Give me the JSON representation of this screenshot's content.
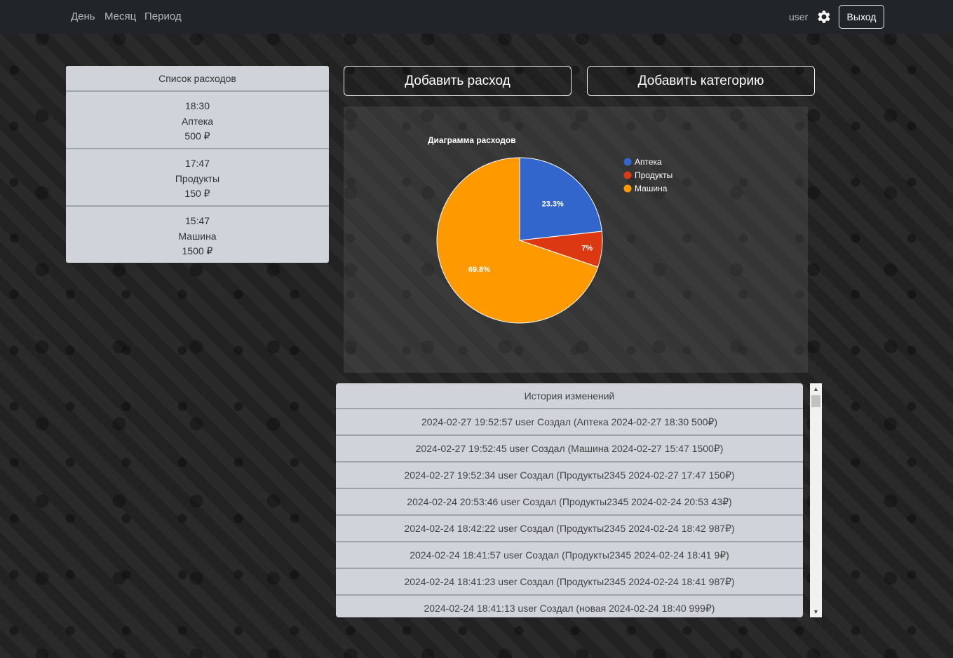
{
  "nav": {
    "links": [
      "День",
      "Месяц",
      "Период"
    ],
    "user": "user",
    "logout": "Выход"
  },
  "expenses": {
    "title": "Список расходов",
    "items": [
      {
        "time": "18:30",
        "category": "Аптека",
        "amount": "500 ₽"
      },
      {
        "time": "17:47",
        "category": "Продукты",
        "amount": "150 ₽"
      },
      {
        "time": "15:47",
        "category": "Машина",
        "amount": "1500 ₽"
      }
    ]
  },
  "actions": {
    "add_expense": "Добавить расход",
    "add_category": "Добавить категорию"
  },
  "chart_data": {
    "type": "pie",
    "title": "Диаграмма расходов",
    "categories": [
      "Аптека",
      "Продукты",
      "Машина"
    ],
    "values": [
      500,
      150,
      1500
    ],
    "labels": [
      "23.3%",
      "7%",
      "69.8%"
    ],
    "colors": [
      "#3366cc",
      "#dc3912",
      "#ff9900"
    ],
    "legend": "right"
  },
  "history": {
    "title": "История изменений",
    "rows": [
      "2024-02-27 19:52:57 user Создал (Аптека 2024-02-27 18:30 500₽)",
      "2024-02-27 19:52:45 user Создал (Машина 2024-02-27 15:47 1500₽)",
      "2024-02-27 19:52:34 user Создал (Продукты2345 2024-02-27 17:47 150₽)",
      "2024-02-24 20:53:46 user Создал (Продукты2345 2024-02-24 20:53 43₽)",
      "2024-02-24 18:42:22 user Создал (Продукты2345 2024-02-24 18:42 987₽)",
      "2024-02-24 18:41:57 user Создал (Продукты2345 2024-02-24 18:41 9₽)",
      "2024-02-24 18:41:23 user Создал (Продукты2345 2024-02-24 18:41 987₽)",
      "2024-02-24 18:41:13 user Создал (новая 2024-02-24 18:40 999₽)"
    ]
  }
}
